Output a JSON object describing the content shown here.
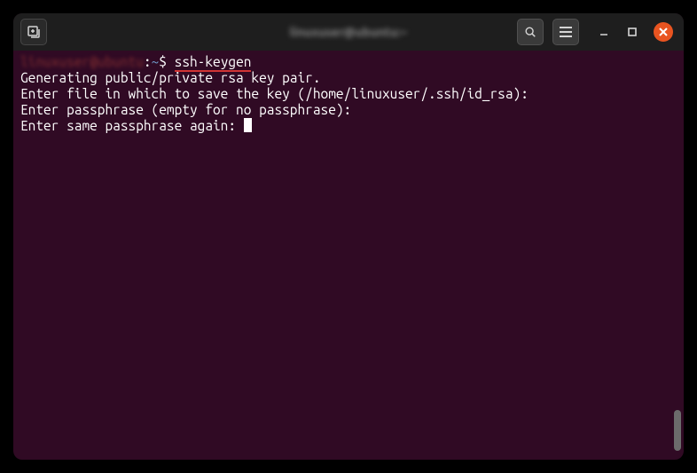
{
  "titlebar": {
    "title": "linuxuser@ubuntu:~"
  },
  "terminal": {
    "user_host": "linuxuser@ubuntu",
    "sep": ":",
    "path": "~",
    "prompt": "$ ",
    "command": "ssh-keygen",
    "lines": {
      "l1": "Generating public/private rsa key pair.",
      "l2": "Enter file in which to save the key (/home/linuxuser/.ssh/id_rsa):",
      "l3": "Enter passphrase (empty for no passphrase):",
      "l4": "Enter same passphrase again: "
    }
  },
  "icons": {
    "new_tab": "new-tab-icon",
    "search": "search-icon",
    "menu": "hamburger-icon",
    "minimize": "minimize-icon",
    "maximize": "maximize-icon",
    "close": "close-icon"
  }
}
